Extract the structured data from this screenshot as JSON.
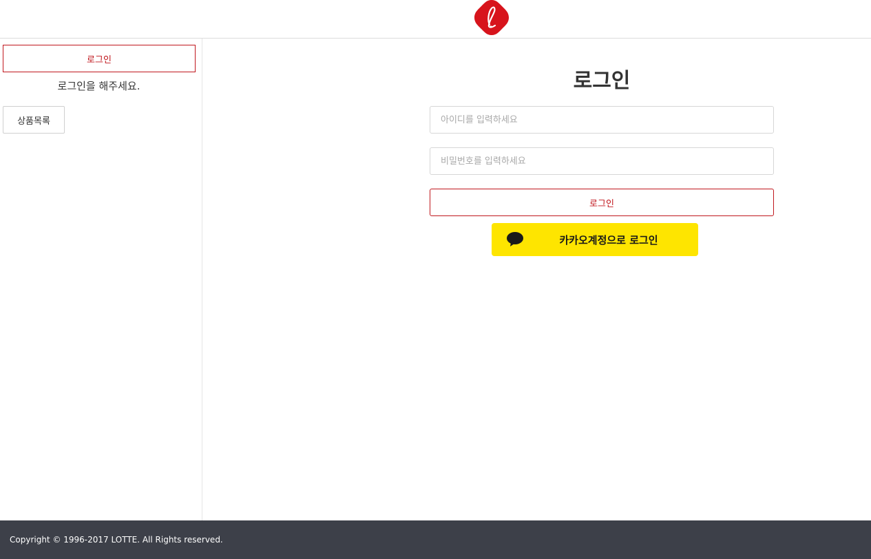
{
  "header": {
    "logo_icon": "lotte-logo-icon",
    "brand_color": "#d7141c"
  },
  "sidebar": {
    "login_label": "로그인",
    "message": "로그인을 해주세요.",
    "products_label": "상품목록"
  },
  "main": {
    "title": "로그인",
    "id_placeholder": "아이디를 입력하세요",
    "pw_placeholder": "비밀번호를 입력하세요",
    "login_label": "로그인",
    "kakao_label": "카카오계정으로 로그인",
    "kakao_icon": "speech-bubble-icon",
    "kakao_color": "#fee500"
  },
  "footer": {
    "copyright": "Copyright © 1996-2017 LOTTE. All Rights reserved."
  }
}
